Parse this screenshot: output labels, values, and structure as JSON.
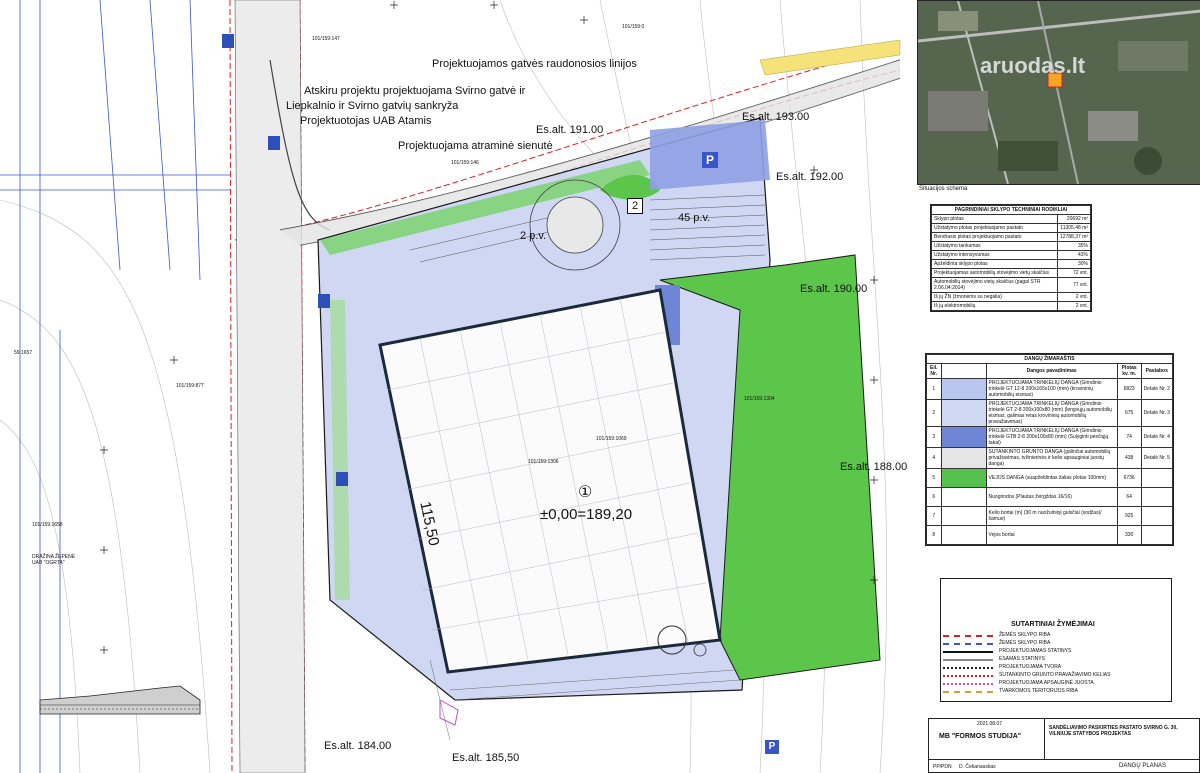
{
  "plan": {
    "notes": {
      "red_line": "Projektuojamos gatvės raudonosios linijos",
      "intersection_1": "Atskiru projektu projektuojama Svirno gatvė ir",
      "intersection_2": "Liepkalnio ir Svirno gatvių sankryža",
      "intersection_3": "Projektuotojas UAB Atamis",
      "retaining_wall": "Projektuojama atraminė sienutė"
    },
    "building": {
      "number": "①",
      "elevation": "±0,00=189,20",
      "side_length": "115,50"
    },
    "elevations": {
      "e191": "Es.alt. 191.00",
      "e193": "Es.alt. 193.00",
      "e192": "Es.alt. 192.00",
      "e190": "Es.alt. 190.00",
      "e188": "Es.alt. 188.00",
      "e184": "Es.alt. 184.00",
      "e185": "Es.alt. 185,50"
    },
    "parking": {
      "p45": "45 p.v.",
      "p2": "2 p.v.",
      "marker": "2"
    },
    "parcels": {
      "left_top": "59.1657",
      "left_mid": "101/159:877",
      "left_bot": "101/159:1658",
      "left_owner": "DRAŽINA ŽEPENĖ",
      "center": "101/159:1069",
      "center2": "101/159:1306",
      "right": "101/159:1304",
      "top1": "101/159:147",
      "top2": "101/159:0",
      "road": "101/159:146",
      "owner": "UAB \"OGRTA\""
    },
    "signs": {
      "parking_sign": "P"
    }
  },
  "situation": {
    "caption": "Situacijos schema",
    "watermark": "aruodas.lt"
  },
  "params": {
    "title": "PAGRINDINIAI SKLYPO TECHNINIAI RODIKLIAI",
    "rows": [
      {
        "label": "Sklypo plotas",
        "value": "20692 m²"
      },
      {
        "label": "Užstatymo plotas projektuojamo pastato",
        "value": "11305,48 m²"
      },
      {
        "label": "Bendrasis plotas projektuojamo pastato",
        "value": "12788,37 m²"
      },
      {
        "label": "Užstatymo tankumas",
        "value": "35%"
      },
      {
        "label": "Užstatymo intensyvumas",
        "value": "43%"
      },
      {
        "label": "Apželdinta sklypo plotas",
        "value": "30%"
      },
      {
        "label": "Projektuojamas automobilių stovėjimo vietų skaičius",
        "value": "72 vnt."
      },
      {
        "label": "Automobilių stovėjimo vietų skaičius (pagal STR 2.06.04:2014)",
        "value": "77 vnt."
      },
      {
        "label": "Iš jų ŽN (žmonėms su negalia)",
        "value": "2 vnt."
      },
      {
        "label": "Iš jų elektromobilių",
        "value": "2 vnt."
      }
    ]
  },
  "legend": {
    "title": "DANGŲ ŽIMARAŠTIS",
    "headers": [
      "Eil. Nr.",
      "Dangos pavadinimas",
      "Plotas kv. m.",
      "Pastabos"
    ],
    "rows": [
      {
        "n": "1",
        "name": "PROJEKTUOJAMA TRINKELIŲ DANGA (Grindinio trinkelė GT 12-8 200x165x100 (mm) (krovininių automobilių eismas)",
        "area": "6823",
        "note": "Detalė Nr. 2",
        "color": "#b9c6ee"
      },
      {
        "n": "2",
        "name": "PROJEKTUOJAMA TRINKELIŲ DANGA (Grindinio trinkelė GT 2-8 200x100x80 (mm) (lengvųjų automobilių eismas, galimas retas krovininių automobilių pravažiavimas)",
        "area": "675",
        "note": "Detalė Nr. 3",
        "color": "#cfd8f3"
      },
      {
        "n": "3",
        "name": "PROJEKTUOJAMA TRINKELIŲ DANGA (Grindinio trinkelė GTB 2-8 200x100x80 (mm) (Sulyginti pėsčiųjų takai)",
        "area": "74",
        "note": "Detalė Nr. 4",
        "color": "#6f86d6"
      },
      {
        "n": "4",
        "name": "SUTANKINTO GRUNTO DANGA (galinčiai automobilių privažiavimas, tvžinierinės ir kelio apsauginiai juostų danga)",
        "area": "438",
        "note": "Detalė Nr. 5",
        "color": "#e6e6e6"
      },
      {
        "n": "5",
        "name": "VEJOS DANGA (suapželdintas žalias plotas 100mm)",
        "area": "6736",
        "note": "",
        "color": "#57c04f"
      },
      {
        "n": "6",
        "name": "Nuogrindos (Plautas žvirgždas 16/16)",
        "area": "64",
        "note": "",
        "color": ""
      },
      {
        "n": "7",
        "name": "Kelio bortai (m) (30 m nuožulnioji gulsčiai (sodžas)/šamuo)",
        "area": "925",
        "note": "",
        "color": ""
      },
      {
        "n": "8",
        "name": "Vejos bortai",
        "area": "330",
        "note": "",
        "color": ""
      }
    ]
  },
  "symbols": {
    "title": "SUTARTINIAI ŽYMĖJIMAI",
    "items": [
      "ŽEMĖS SKLYPO RIBA",
      "ŽEMĖS SKLYPO RIBA",
      "PROJEKTUOJAMAS STATINYS",
      "ESAMAS STATINYS",
      "PROJEKTUOJAMA TVORA",
      "SUTANKINTO GRUNTO PRAVAŽIAVIMO KELIAS",
      "PROJEKTUOJAMA APSAUGINĖ JUOSTA",
      "TVARKOMOS TERITORIJOS RIBA"
    ]
  },
  "title_block": {
    "company": "MB \"FORMOS STUDIJA\"",
    "project": "SANDĖLIAVIMO PASKIRTIES PASTATO SVIRNO G. 30, VILNIUJE STATYBOS PROJEKTAS",
    "sheet": "DANGŲ PLANAS",
    "date": "2021.08.07",
    "stage": "PP/PDN",
    "designer": "D. Čekanauskas"
  },
  "colors": {
    "green": "#5cc64a",
    "pavement": "#c9d4f4",
    "parcel": "#1a1a1a",
    "red": "#d71f26"
  }
}
